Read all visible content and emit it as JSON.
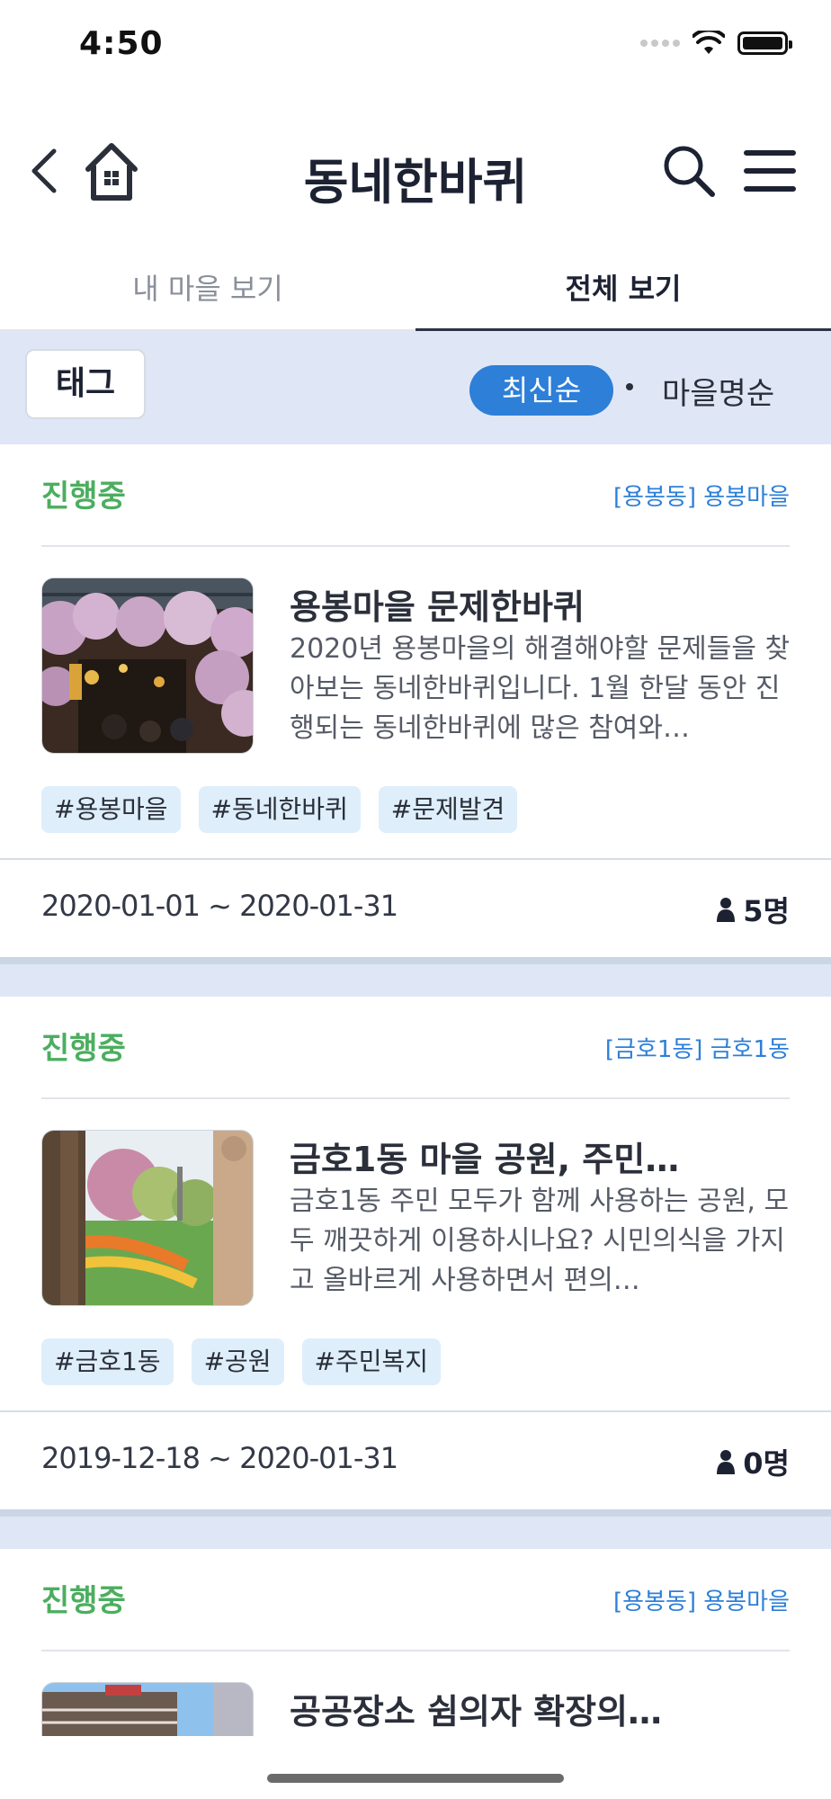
{
  "status_bar": {
    "time": "4:50"
  },
  "header": {
    "title": "동네한바퀴"
  },
  "tabs": [
    {
      "label": "내 마을 보기",
      "active": false
    },
    {
      "label": "전체 보기",
      "active": true
    }
  ],
  "filter": {
    "tag_button": "태그",
    "sort_options": [
      "최신순",
      "마을명순"
    ],
    "selected_sort": "최신순"
  },
  "colors": {
    "accent": "#2d7fd8",
    "status_green": "#4bae5f",
    "filter_bg": "#dfe7f6",
    "tag_bg": "#dfeefb"
  },
  "cards": [
    {
      "status": "진행중",
      "region": "[용봉동] 용봉마을",
      "title": "용봉마을 문제한바퀴",
      "description": "2020년 용봉마을의 해결해야할 문제들을 찾아보는 동네한바퀴입니다. 1월 한달 동안 진행되는 동네한바퀴에 많은 참여와…",
      "tags": [
        "#용봉마을",
        "#동네한바퀴",
        "#문제발견"
      ],
      "dates": "2020-01-01 ~ 2020-01-31",
      "members": "5명"
    },
    {
      "status": "진행중",
      "region": "[금호1동] 금호1동",
      "title": "금호1동 마을 공원, 주민…",
      "description": "금호1동 주민 모두가 함께 사용하는 공원, 모두 깨끗하게 이용하시나요? 시민의식을 가지고 올바르게 사용하면서 편의…",
      "tags": [
        "#금호1동",
        "#공원",
        "#주민복지"
      ],
      "dates": "2019-12-18 ~ 2020-01-31",
      "members": "0명"
    },
    {
      "status": "진행중",
      "region": "[용봉동] 용봉마을",
      "title": "공공장소 쉼의자 확장의…"
    }
  ]
}
